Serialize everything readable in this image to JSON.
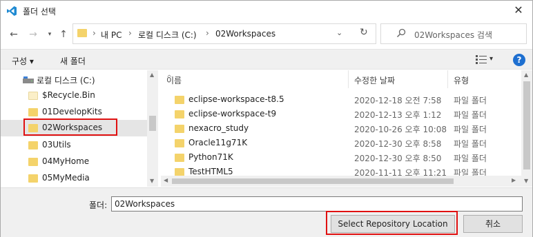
{
  "window": {
    "title": "폴더 선택",
    "app_icon": "vscode-icon",
    "close_label": "✕"
  },
  "address": {
    "crumbs": [
      "내 PC",
      "로컬 디스크 (C:)",
      "02Workspaces"
    ],
    "separator": "›"
  },
  "search": {
    "placeholder": "02Workspaces 검색"
  },
  "toolbar": {
    "organize": "구성 ▾",
    "new_folder": "새 폴더",
    "help": "?"
  },
  "tree": {
    "drive": "로컬 디스크 (C:)",
    "items": [
      {
        "label": "$Recycle.Bin"
      },
      {
        "label": "01DevelopKits"
      },
      {
        "label": "02Workspaces"
      },
      {
        "label": "03Utils"
      },
      {
        "label": "04MyHome"
      },
      {
        "label": "05MyMedia"
      }
    ]
  },
  "list": {
    "headers": {
      "name": "이름",
      "date": "수정한 날짜",
      "type": "유형"
    },
    "rows": [
      {
        "name": "eclipse-workspace-t8.5",
        "date": "2020-12-18 오전 7:58",
        "type": "파일 폴더"
      },
      {
        "name": "eclipse-workspace-t9",
        "date": "2020-12-13 오후 1:12",
        "type": "파일 폴더"
      },
      {
        "name": "nexacro_study",
        "date": "2020-10-26 오후 10:08",
        "type": "파일 폴더"
      },
      {
        "name": "Oracle11g71K",
        "date": "2020-12-30 오후 8:58",
        "type": "파일 폴더"
      },
      {
        "name": "Python71K",
        "date": "2020-12-30 오후 8:50",
        "type": "파일 폴더"
      },
      {
        "name": "TestHTML5",
        "date": "2020-11-11 오후 11:21",
        "type": "파일 폴더"
      }
    ]
  },
  "bottom": {
    "folder_label": "폴더:",
    "folder_value": "02Workspaces",
    "select_button": "Select Repository Location",
    "cancel_button": "취소"
  },
  "colors": {
    "folder": "#f4d36b",
    "highlight": "#e01010",
    "help": "#1e6fd0"
  }
}
